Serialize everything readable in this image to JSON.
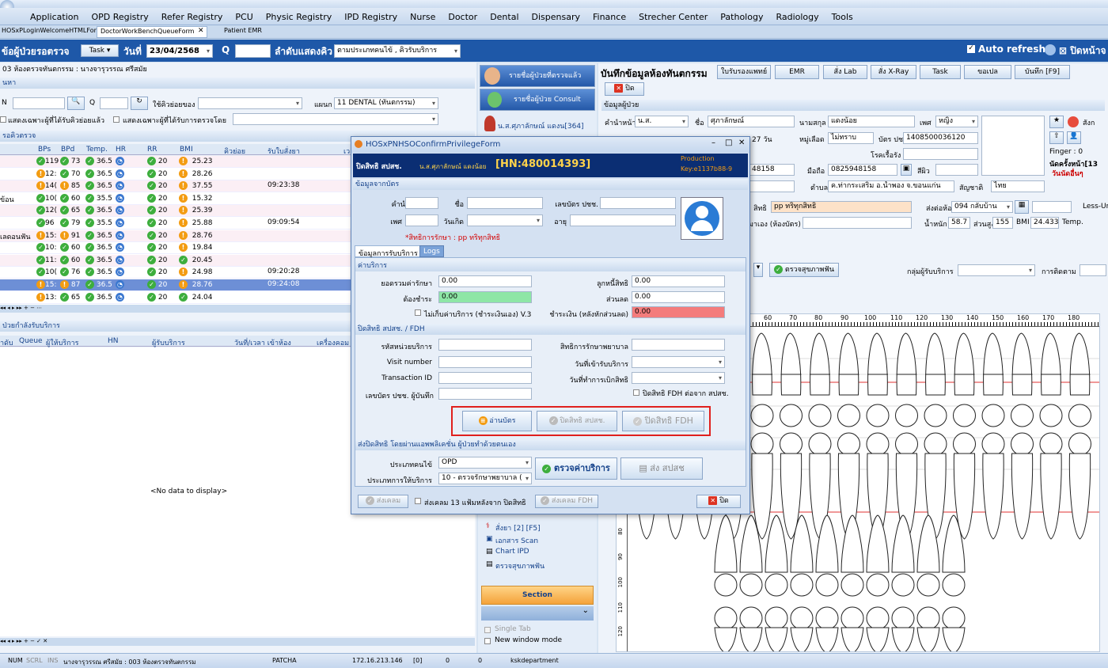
{
  "menu": [
    "Application",
    "OPD Registry",
    "Refer Registry",
    "PCU",
    "Physic Registry",
    "IPD Registry",
    "Nurse",
    "Doctor",
    "Dental",
    "Dispensary",
    "Finance",
    "Strecher Center",
    "Pathology",
    "Radiology",
    "Tools"
  ],
  "doc_tabs": [
    "HOSxPLoginWelcomeHTMLForm",
    "DoctorWorkBenchQueueForm",
    "Patient EMR"
  ],
  "toolbar": {
    "title": "ข้อผู้ป่วยรอตรวจ",
    "task": "Task",
    "date_label": "วันที่",
    "date": "23/04/2568",
    "q_label": "Q",
    "order_label": "ลำดับแสดงคิว",
    "order_value": "ตามประเภทคนไข้ , คิวรับบริการ",
    "auto_refresh": "Auto refresh",
    "close_right": "ปิดหน้าจ"
  },
  "left": {
    "room": "03 ห้องตรวจทันตกรรม : นางจารุวรรณ  ศรีสมัย",
    "search_hdr": "นหา",
    "hn": "N",
    "q": "Q",
    "use_queue": "ใช้คิวย่อยของ",
    "dept_label": "แผนก",
    "dept": "11 DENTAL (ทันตกรรม)",
    "chk1": "แสดงเฉพาะผู้ที่ได้รับคิวย่อยแล้ว",
    "chk2": "แสดงเฉพาะผู้ที่ได้รับการตรวจโดย",
    "queue_hdr": "รอคิวตรวจ",
    "cols": [
      "BPs",
      "BPd",
      "Temp.",
      "HR",
      "RR",
      "BMI",
      "คิวย่อย",
      "รับใบสั่งยา",
      "เว"
    ],
    "rows": [
      {
        "name": "",
        "bps": "119",
        "bpd": "73",
        "temp": "36.5",
        "rr": "20",
        "bmi": "25.23",
        "rx": "",
        "w1": "gr",
        "w2": "gr",
        "wb": "or"
      },
      {
        "name": "",
        "bps": "12:",
        "bpd": "70",
        "temp": "36.5",
        "rr": "20",
        "bmi": "28.26",
        "rx": "",
        "w1": "or",
        "w2": "gr",
        "wb": "or"
      },
      {
        "name": "",
        "bps": "14(",
        "bpd": "85",
        "temp": "36.5",
        "rr": "20",
        "bmi": "37.55",
        "rx": "09:23:38",
        "w1": "or",
        "w2": "or",
        "wb": "or"
      },
      {
        "name": "ข้อน",
        "bps": "10(",
        "bpd": "60",
        "temp": "35.5",
        "rr": "20",
        "bmi": "15.32",
        "rx": "",
        "w1": "gr",
        "w2": "gr",
        "wb": "or"
      },
      {
        "name": "",
        "bps": "12(",
        "bpd": "65",
        "temp": "36.5",
        "rr": "20",
        "bmi": "25.39",
        "rx": "",
        "w1": "gr",
        "w2": "gr",
        "wb": "or"
      },
      {
        "name": "",
        "bps": "96",
        "bpd": "79",
        "temp": "35.5",
        "rr": "20",
        "bmi": "25.88",
        "rx": "09:09:54",
        "w1": "gr",
        "w2": "gr",
        "wb": "or"
      },
      {
        "name": "เลดอนฟัน",
        "bps": "15:",
        "bpd": "91",
        "temp": "36.5",
        "rr": "20",
        "bmi": "28.76",
        "rx": "",
        "w1": "or",
        "w2": "or",
        "wb": "or"
      },
      {
        "name": "",
        "bps": "10:",
        "bpd": "60",
        "temp": "36.5",
        "rr": "20",
        "bmi": "19.84",
        "rx": "",
        "w1": "gr",
        "w2": "gr",
        "wb": "or"
      },
      {
        "name": "",
        "bps": "11:",
        "bpd": "60",
        "temp": "36.5",
        "rr": "20",
        "bmi": "20.45",
        "rx": "",
        "w1": "gr",
        "w2": "gr",
        "wb": "gr"
      },
      {
        "name": "",
        "bps": "10(",
        "bpd": "76",
        "temp": "36.5",
        "rr": "20",
        "bmi": "24.98",
        "rx": "09:20:28",
        "w1": "gr",
        "w2": "gr",
        "wb": "or"
      },
      {
        "name": "",
        "bps": "15:",
        "bpd": "87",
        "temp": "36.5",
        "rr": "20",
        "bmi": "28.76",
        "rx": "09:24:08",
        "w1": "or",
        "w2": "or",
        "wb": "or",
        "sel": true
      },
      {
        "name": "",
        "bps": "13:",
        "bpd": "65",
        "temp": "36.5",
        "rr": "20",
        "bmi": "24.04",
        "rx": "",
        "w1": "or",
        "w2": "gr",
        "wb": "gr"
      }
    ],
    "served_hdr": "ป่วยกำลังรับบริการ",
    "served_cols": [
      "ำดับ",
      "Queue",
      "ผู้ให้บริการ",
      "HN",
      "ผู้รับบริการ",
      "วันที่/เวลา เข้าห้อง",
      "เครื่องคอม"
    ],
    "no_data": "<No data to display>"
  },
  "mid": {
    "btn1": "รายชื่อผู้ป่วยที่ตรวจแล้ว",
    "btn2": "รายชื่อผู้ป่วย Consult",
    "patient": "น.ส.ศุภาลักษณ์ แดงน[364]",
    "items": [
      "สั่งยา [2] [F5]",
      "เอกสาร Scan",
      "Chart IPD",
      "ตรวจสุขภาพฟัน"
    ],
    "section": "Section",
    "single_tab": "Single Tab",
    "new_window": "New window mode"
  },
  "right": {
    "title": "บันทึกข้อมูลห้องทันตกรรม",
    "tabs": [
      "ใบรับรองแพทย์",
      "EMR",
      "สั่ง Lab",
      "สั่ง X-Ray",
      "Task",
      "ขอเปล",
      "บันทึก [F9]"
    ],
    "close": "ปิด",
    "info_hdr": "ข้อมูลผู้ป่วย",
    "prefix_label": "คำนำหน้า",
    "prefix": "น.ส.",
    "fname_label": "ชื่อ",
    "fname": "ศุภาลักษณ์",
    "lname_label": "นามสกุล",
    "lname": "แดงน้อย",
    "sex_label": "เพศ",
    "sex": "หญิง",
    "age": "27 วัน",
    "blood_label": "หมู่เลือด",
    "blood": "ไม่ทราบ",
    "cid_label": "บัตร ปชช.",
    "cid": "1408500036120",
    "chronic_label": "โรคเรื้อรัง",
    "hn_part": "48158",
    "mobile_label": "มือถือ",
    "mobile": "0825948158",
    "skin_label": "สีผิว",
    "tambon_label": "ตำบล",
    "tambon": "ค.ท่ากระเสริม อ.น้ำพอง จ.ขอนแก่น",
    "nation_label": "สัญชาติ",
    "nation": "ไทย",
    "right_label": "สิทธิ",
    "right_val": "pp ทริทุกสิทธิ",
    "send_label": "ส่งต่อห้อง",
    "send": "094 กลับบ้าน",
    "less": "Less-Ur",
    "self_pay": "มาเอง (ห้องบัตร)",
    "weight_label": "น้ำหนัก",
    "weight": "58.7",
    "height_label": "ส่วนสูง",
    "height": "155",
    "bmi_label": "BMI",
    "bmi": "24.433",
    "temp_label": "Temp.",
    "finger": "Finger : 0",
    "appoint": "นัดครั้งหน้า[13",
    "appoint2": "วันนัดอื่นๆ",
    "dental_btn": "ตรวจสุขภาพฟัน",
    "group_label": "กลุ่มผู้รับบริการ",
    "follow_label": "การติดตาม",
    "side_label": "สังก",
    "ruler": [
      "60",
      "70",
      "80",
      "90",
      "100",
      "110",
      "120",
      "130",
      "140",
      "150",
      "160",
      "170",
      "180"
    ],
    "vruler": [
      "80",
      "90",
      "100",
      "110",
      "120"
    ]
  },
  "dialog": {
    "title": "HOSxPNHSOConfirmPrivilegeForm",
    "head_left": "ปิดสิทธิ สปสช.",
    "head_patient": "น.ส.ศุภาลักษณ์ แดงน้อย",
    "head_hn": "[HN:480014393]",
    "prod": "Production",
    "key": "Key:e1137b88-9",
    "card_hdr": "ข้อมูลจากบัตร",
    "prefix": "คำนำหน้า",
    "name": "ชื่อ",
    "cid": "เลขบัตร ปชช.",
    "sex": "เพศ",
    "dob": "วันเกิด",
    "age": "อายุ",
    "right_note": "*สิทธิการรักษา : pp ทริทุกสิทธิ",
    "tabs": [
      "ข้อมูลการรับบริการ",
      "Logs"
    ],
    "svc_hdr": "ค่าบริการ",
    "total_label": "ยอดรวมค่ารักษา",
    "total": "0.00",
    "debtor_label": "ลูกหนี้สิทธิ",
    "debtor": "0.00",
    "pay_label": "ต้องชำระ",
    "pay": "0.00",
    "disc_label": "ส่วนลด",
    "disc": "0.00",
    "nocharge": "ไม่เก็บค่าบริการ (ชำระเงินเอง) V.3",
    "cash_label": "ชำระเงิน (หลังหักส่วนลด)",
    "cash": "0.00",
    "fdh_hdr": "ปิดสิทธิ สปสช. / FDH",
    "unit_label": "รหัสหน่วยบริการ",
    "rights_label": "สิทธิการรักษาพยาบาล",
    "visit_label": "Visit number",
    "visit_date_label": "วันที่เข้ารับบริการ",
    "trans_label": "Transaction ID",
    "claim_date_label": "วันที่ทำการเบิกสิทธิ",
    "cid_rec_label": "เลขบัตร ปชช. ผู้บันทึก",
    "fdh_chk": "ปิดสิทธิ FDH ต่อจาก สปสช.",
    "read_card": "อ่านบัตร",
    "close_nhso": "ปิดสิทธิ สปสช.",
    "close_fdh": "ปิดสิทธิ FDH",
    "app_hdr": "ส่งปิดสิทธิ โดยผ่านแอพพลิเคชั่น ผู้ป่วยทำด้วยตนเอง",
    "ptype_label": "ประเภทคนไข้",
    "ptype": "OPD",
    "stype_label": "ประเภทการให้บริการ",
    "stype": "10 - ตรวจรักษาพยาบาล (",
    "check_btn": "ตรวจค่าบริการ",
    "send_btn": "ส่ง สปสช",
    "send13": "ส่งเคลม",
    "send13_chk": "ส่งเคลม 13 แฟ้มหลังจาก ปิดสิทธิ",
    "send_fdh": "ส่งเคลม FDH",
    "close": "ปิด"
  },
  "status": {
    "num": "NUM",
    "scrl": "SCRL",
    "ins": "INS",
    "user": "นางจารุวรรณ  ศรีสมัย : 003 ห้องตรวจทันตกรรม",
    "server": "PATCHA",
    "ip": "172.16.213.146",
    "s1": "[0]",
    "s2": "0",
    "s3": "0",
    "dept": "kskdepartment"
  }
}
